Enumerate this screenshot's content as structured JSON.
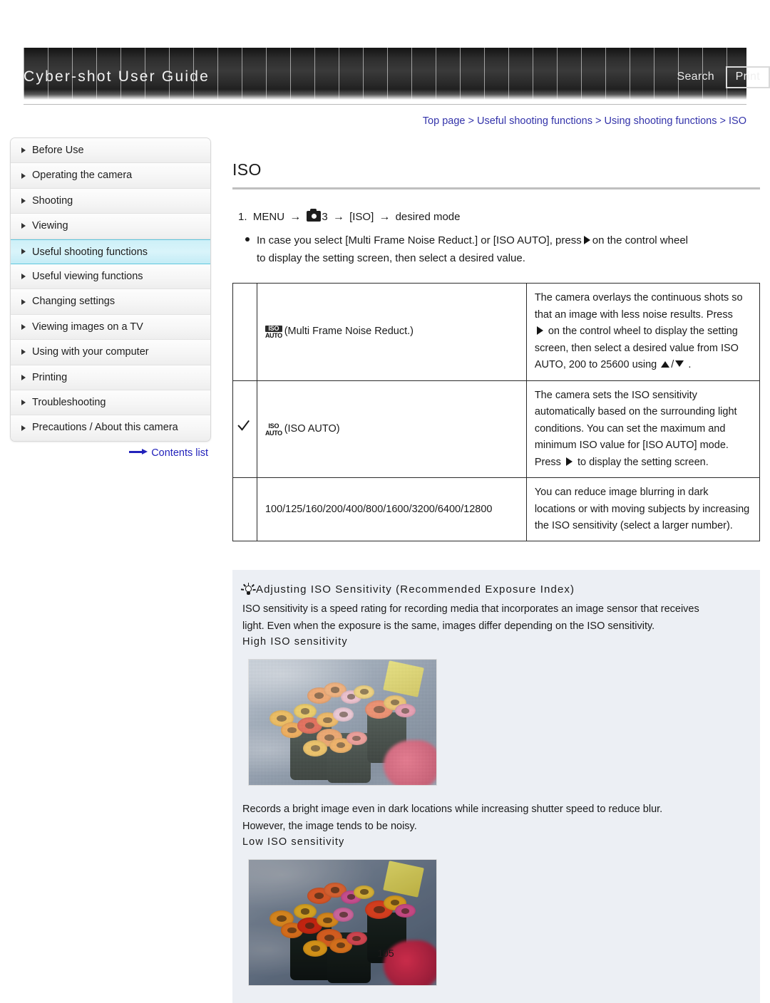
{
  "header": {
    "title": "Cyber-shot User Guide",
    "search_label": "Search",
    "print_label": "Print"
  },
  "breadcrumb": {
    "text": "Top page > Useful shooting functions > Using shooting functions > ISO"
  },
  "sidebar": {
    "items": [
      {
        "label": "Before Use",
        "active": false
      },
      {
        "label": "Operating the camera",
        "active": false
      },
      {
        "label": "Shooting",
        "active": false
      },
      {
        "label": "Viewing",
        "active": false
      },
      {
        "label": "Useful shooting functions",
        "active": true
      },
      {
        "label": "Useful viewing functions",
        "active": false
      },
      {
        "label": "Changing settings",
        "active": false
      },
      {
        "label": "Viewing images on a TV",
        "active": false
      },
      {
        "label": "Using with your computer",
        "active": false
      },
      {
        "label": "Printing",
        "active": false
      },
      {
        "label": "Troubleshooting",
        "active": false
      },
      {
        "label": "Precautions / About this camera",
        "active": false
      }
    ],
    "contents_link": "Contents list"
  },
  "main": {
    "page_title": "ISO",
    "step_number": "1.",
    "step_menu": "MENU",
    "step_menu_number": "3",
    "step_iso": "[ISO]",
    "step_desired": "desired mode",
    "bullet_part1": "In case you select [Multi Frame Noise Reduct.] or [ISO AUTO], press",
    "bullet_part2": "on the control wheel",
    "bullet_line2": "to display the setting screen, then select a desired value.",
    "table": {
      "rows": [
        {
          "check": false,
          "icon": "iso-auto-boxed-icon",
          "mode": "(Multi Frame Noise Reduct.)",
          "desc_line1": "The camera overlays the continuous shots so",
          "desc_line2": "that an image with less noise results. Press",
          "desc_line3_pre": "",
          "desc_line3_post": "on the control wheel to display the setting",
          "desc_line4": "screen, then select a desired value from ISO",
          "desc_line5_pre": "AUTO, 200 to 25600 using",
          "desc_line5_post": "."
        },
        {
          "check": true,
          "icon": "iso-auto-icon",
          "mode": "(ISO AUTO)",
          "desc_line1": "The camera sets the ISO sensitivity",
          "desc_line2": "automatically based on the surrounding light",
          "desc_line3_post": "conditions. You can set the maximum and",
          "desc_line4": "minimum ISO value for [ISO AUTO] mode.",
          "desc_line5_pre": "Press",
          "desc_line5_post": "to display the setting screen."
        },
        {
          "check": false,
          "icon": "",
          "mode": "100/125/160/200/400/800/1600/3200/6400/12800",
          "desc_line1": "You can reduce image blurring in dark",
          "desc_line2": "locations or with moving subjects by increasing",
          "desc_line3_post": "the ISO sensitivity (select a larger number)."
        }
      ]
    },
    "tip": {
      "heading": "Adjusting ISO Sensitivity (Recommended Exposure Index)",
      "paragraph_line1": "ISO sensitivity is a speed rating for recording media that incorporates an image sensor that receives",
      "paragraph_line2": "light. Even when the exposure is the same, images differ depending on the ISO sensitivity.",
      "high_heading": "High ISO sensitivity",
      "high_caption_line1": "Records a bright image even in dark locations while increasing shutter speed to reduce blur.",
      "high_caption_line2": "However, the image tends to be noisy.",
      "low_heading": "Low ISO sensitivity",
      "photo_high_alt": "high-iso-flower-photo",
      "photo_low_alt": "low-iso-flower-photo"
    }
  },
  "footer": {
    "page_number": "105"
  },
  "colors": {
    "accent_link": "#2222bb",
    "breadcrumb": "#3333aa",
    "active_nav_bg": "#d4f2fa",
    "active_nav_border": "#5fc7de",
    "tip_bg": "#eceff4"
  }
}
